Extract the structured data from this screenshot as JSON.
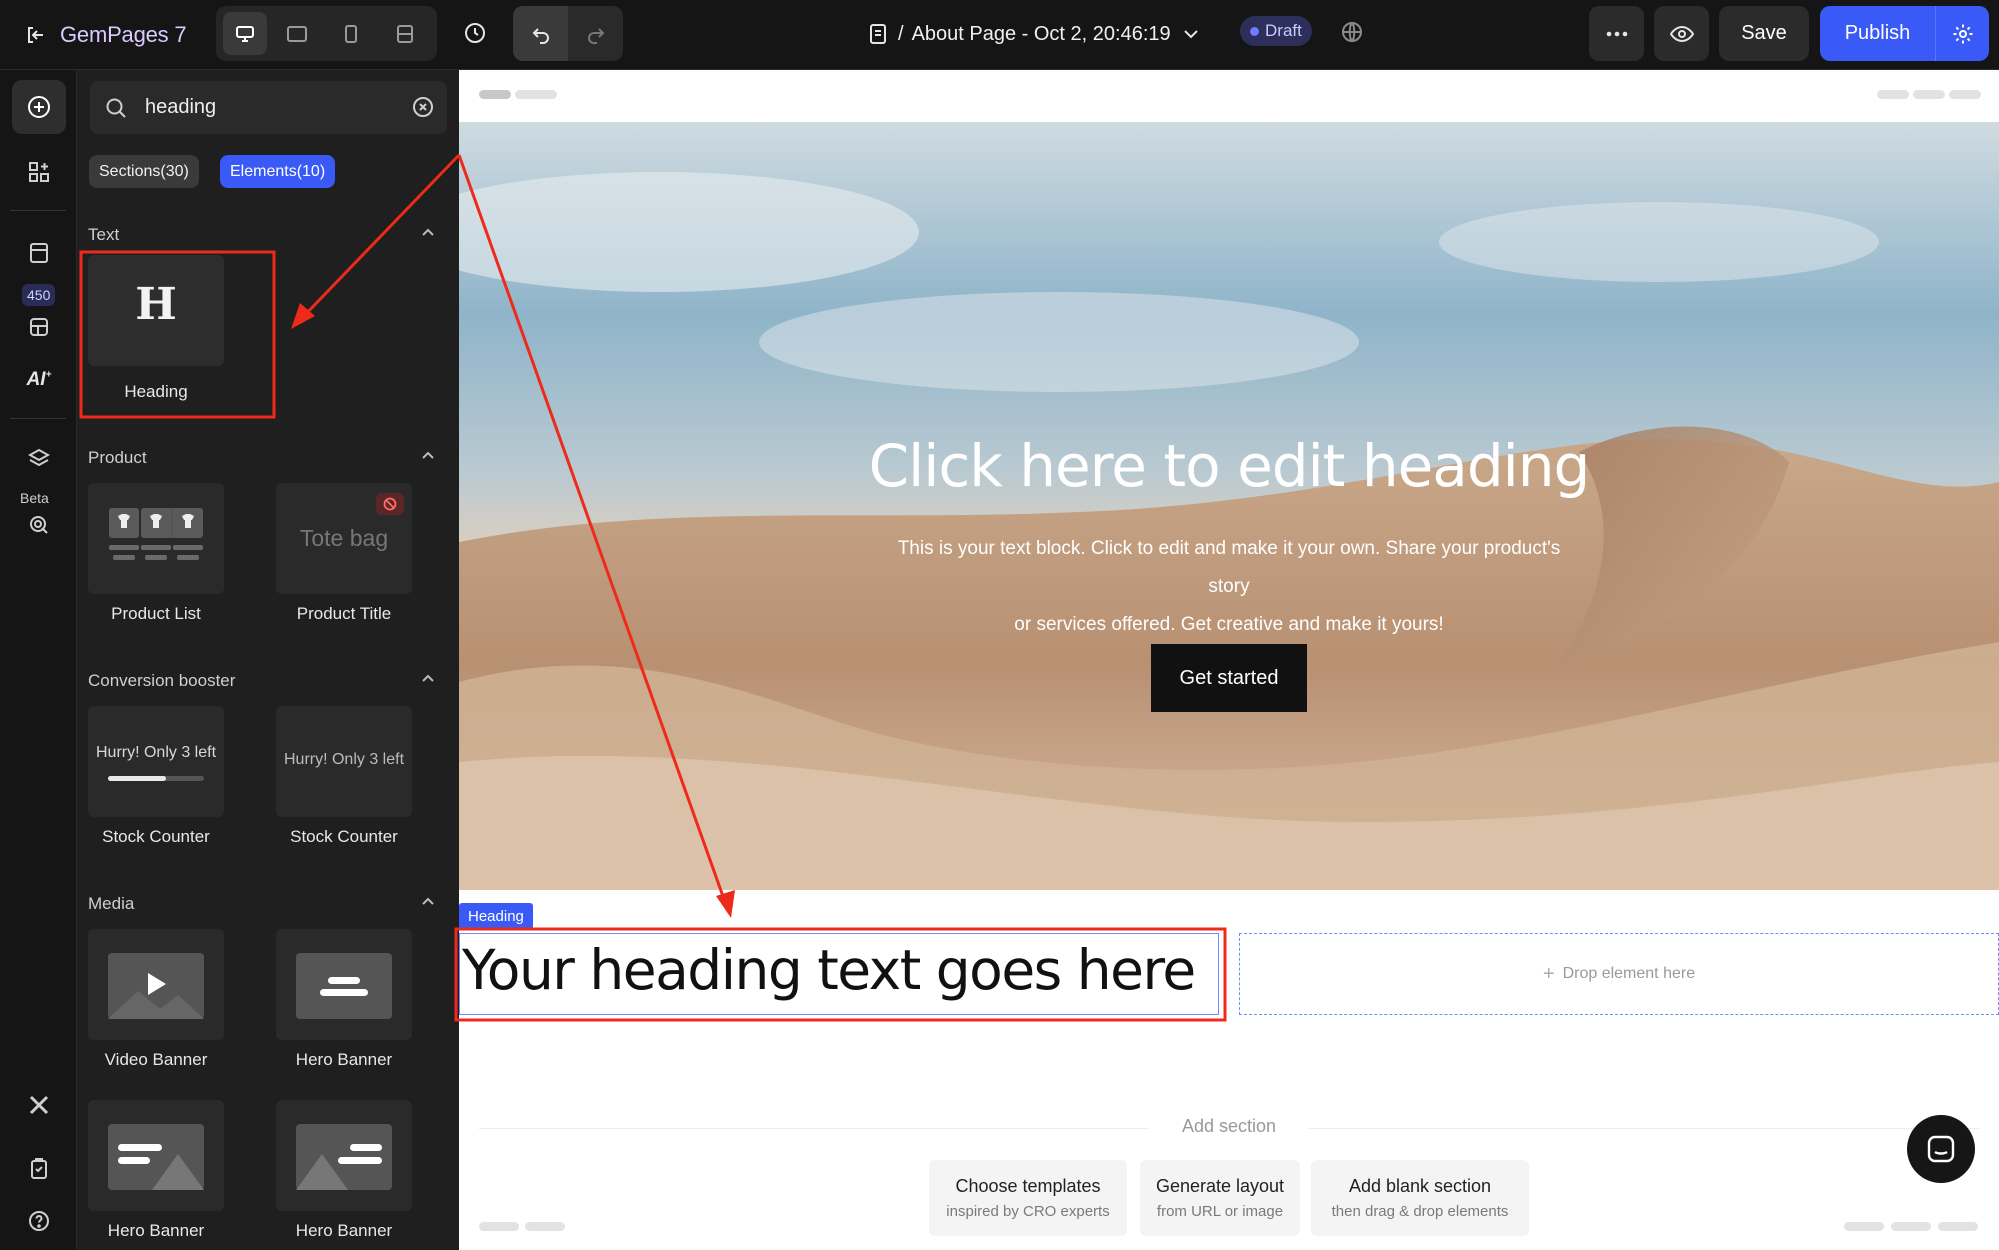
{
  "topbar": {
    "app_name": "GemPages 7",
    "page_breadcrumb_sep": "/",
    "page_title": "About Page - Oct 2, 20:46:19",
    "status_badge": "Draft",
    "save_label": "Save",
    "publish_label": "Publish"
  },
  "iconbar": {
    "count_badge": "450",
    "beta_label": "Beta"
  },
  "panel": {
    "search": {
      "value": "heading"
    },
    "chips": {
      "sections": "Sections(30)",
      "elements": "Elements(10)"
    },
    "sections": {
      "text": "Text",
      "product": "Product",
      "conversion": "Conversion booster",
      "media": "Media"
    },
    "cards": {
      "heading": {
        "glyph": "H",
        "label": "Heading"
      },
      "product_list": {
        "label": "Product List"
      },
      "product_title": {
        "preview": "Tote bag",
        "label": "Product Title"
      },
      "stock_counter_1": {
        "preview": "Hurry! Only 3 left",
        "label": "Stock Counter"
      },
      "stock_counter_2": {
        "preview": "Hurry! Only 3 left",
        "label": "Stock Counter"
      },
      "video_banner": {
        "label": "Video Banner"
      },
      "hero_banner": {
        "label": "Hero Banner"
      },
      "hero_banner_2": {
        "label": "Hero Banner"
      },
      "hero_banner_3": {
        "label": "Hero Banner"
      }
    }
  },
  "canvas": {
    "hero": {
      "heading": "Click here to edit heading",
      "paragraph_line1": "This is your text block. Click to edit and make it your own. Share your product's story",
      "paragraph_line2": "or services offered. Get creative and make it yours!",
      "button": "Get started"
    },
    "heading_tag": "Heading",
    "heading_text": "Your heading text goes here",
    "drop_label": "Drop element here",
    "add_section": {
      "label": "Add section",
      "options": [
        {
          "title": "Choose templates",
          "sub": "inspired by CRO experts"
        },
        {
          "title": "Generate layout",
          "sub": "from URL or image"
        },
        {
          "title": "Add blank section",
          "sub": "then drag & drop elements"
        }
      ]
    }
  },
  "colors": {
    "accent": "#3a5af7",
    "annotation": "#ee2a1b",
    "topbar_bg": "#151515",
    "panel_bg": "#1f1f1f"
  },
  "icons": [
    "exit-icon",
    "desktop-icon",
    "tablet-icon",
    "mobile-icon",
    "responsive-icon",
    "history-icon",
    "undo-icon",
    "redo-icon",
    "page-icon",
    "chevron-down-icon",
    "globe-icon",
    "more-icon",
    "preview-eye-icon",
    "settings-gear-icon",
    "add-plus-icon",
    "elements-icon",
    "pages-icon",
    "templates-icon",
    "ai-icon",
    "layers-icon",
    "beta-target-icon",
    "x-logo-icon",
    "clipboard-icon",
    "help-icon",
    "search-icon",
    "clear-icon",
    "chat-icon"
  ]
}
